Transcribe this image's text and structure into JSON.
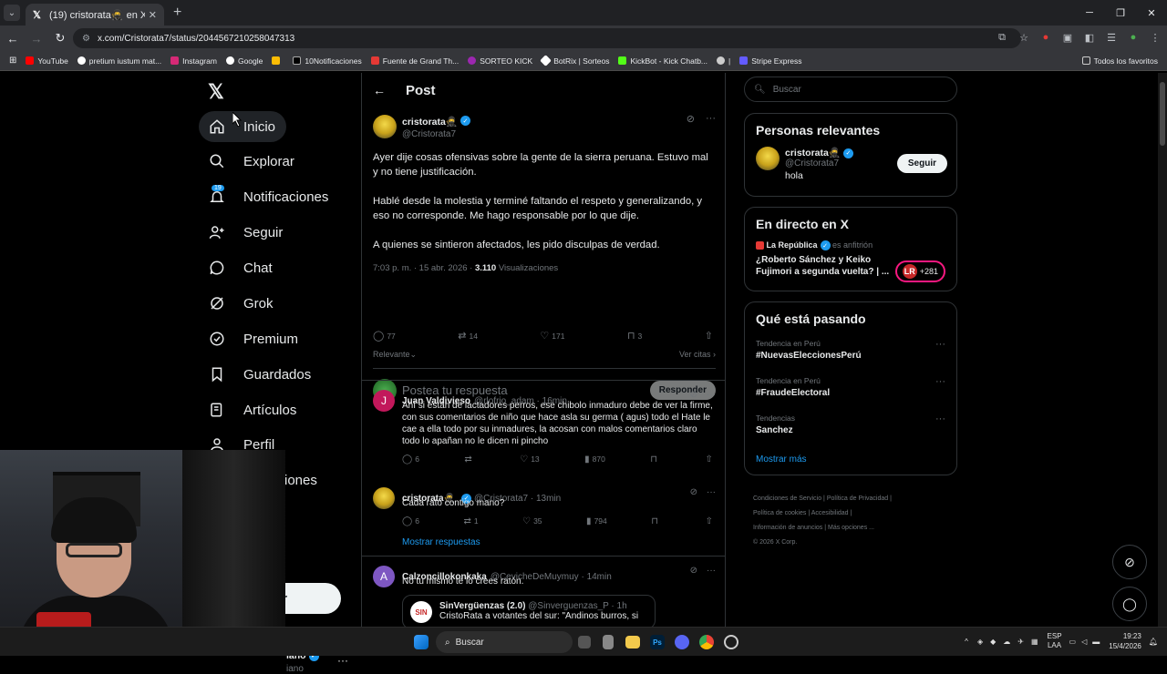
{
  "browser": {
    "tab_title": "(19) cristorata🥷 en X: \"Ayer d...",
    "url": "x.com/Cristorata7/status/2044567210258047313",
    "bookmarks": [
      "YouTube",
      "pretium iustum mat...",
      "Instagram",
      "Google",
      "10Notificaciones",
      "Fuente de Grand Th...",
      "SORTEO KICK",
      "BotRix | Sorteos",
      "KickBot - Kick Chatb...",
      "Stripe Express"
    ],
    "bookmarks_right": "Todos los favoritos"
  },
  "sidebar": {
    "items": [
      {
        "label": "Inicio",
        "icon": "home-icon"
      },
      {
        "label": "Explorar",
        "icon": "search-icon"
      },
      {
        "label": "Notificaciones",
        "icon": "bell-icon",
        "badge": "19"
      },
      {
        "label": "Seguir",
        "icon": "add-user-icon"
      },
      {
        "label": "Chat",
        "icon": "chat-icon"
      },
      {
        "label": "Grok",
        "icon": "grok-icon"
      },
      {
        "label": "Premium",
        "icon": "premium-icon"
      },
      {
        "label": "Guardados",
        "icon": "bookmark-icon"
      },
      {
        "label": "Artículos",
        "icon": "article-icon"
      },
      {
        "label": "Perfil",
        "icon": "profile-icon"
      }
    ],
    "partial_more": "iones",
    "partial_post_btn": "r",
    "partial_user_name": "iano",
    "partial_user_handle": "iano"
  },
  "main": {
    "header_title": "Post",
    "post": {
      "name": "cristorata🥷",
      "handle": "@Cristorata7",
      "paragraphs": [
        "Ayer dije cosas ofensivas sobre la gente de la sierra peruana. Estuvo mal y no tiene justificación.",
        "Hablé desde la molestia y terminé faltando el respeto y generalizando, y eso no corresponde. Me hago responsable por lo que dije.",
        "A quienes se sintieron afectados, les pido disculpas de verdad."
      ],
      "time": "7:03 p. m. · 15 abr. 2026 · ",
      "views": "3.110",
      "views_label": "Visualizaciones",
      "stats": {
        "replies": "77",
        "reposts": "14",
        "likes": "171",
        "bookmarks": "3"
      }
    },
    "sort_label": "Relevante",
    "quotes_label": "Ver citas",
    "reply_placeholder": "Postea tu respuesta",
    "reply_button": "Responder",
    "replies": [
      {
        "name": "Juan Valdivieso",
        "handle": "@rlofrio_adam",
        "time": "16min",
        "initial": "J",
        "text": "Ahí si están de lactadores perros, ese chibolo inmaduro debe de ver la firme, con sus comentarios de niño que hace asla su germa ( agus) todo el Hate le cae a ella todo por su inmadures, la acosan con malos comentarios claro todo lo apañan no le dicen ni pincho",
        "stats": {
          "replies": "6",
          "reposts": "",
          "likes": "13",
          "views": "870"
        }
      },
      {
        "name": "cristorata🥷",
        "handle": "@Cristorata7",
        "time": "13min",
        "text": "Cada rato contigo mano?",
        "stats": {
          "replies": "6",
          "reposts": "1",
          "likes": "35",
          "views": "794"
        },
        "show_more": "Mostrar respuestas"
      },
      {
        "name": "Calzoncillokonkaka",
        "handle": "@CevicheDeMuymuy",
        "time": "14min",
        "initial": "A",
        "text": "No tu mismo te lo crees ratón.",
        "quote": {
          "name": "SinVergüenzas (2.0)",
          "handle": "@Sinverguenzas_P",
          "time": "1h",
          "text": "CristoRata a votantes del sur: \"Andinos burros, si",
          "logo": "SIN"
        }
      }
    ]
  },
  "right": {
    "search_placeholder": "Buscar",
    "relevant_title": "Personas relevantes",
    "relevant_user": {
      "name": "cristorata🥷",
      "handle": "@Cristorata7",
      "bio": "hola",
      "follow": "Seguir"
    },
    "live_title": "En directo en X",
    "live": {
      "source": "La República",
      "host": "es anfitrión",
      "text": "¿Roberto Sánchez y Keiko Fujimori a segunda vuelta? | ...",
      "logo": "LR",
      "count": "+281"
    },
    "trending_title": "Qué está pasando",
    "trends": [
      {
        "context": "Tendencia en Perú",
        "topic": "#NuevasEleccionesPerú"
      },
      {
        "context": "Tendencia en Perú",
        "topic": "#FraudeElectoral"
      },
      {
        "context": "Tendencias",
        "topic": "Sanchez"
      }
    ],
    "show_more": "Mostrar más",
    "footer": [
      "Condiciones de Servicio",
      "Política de Privacidad",
      "Política de cookies",
      "Accesibilidad",
      "Información de anuncios",
      "Más opciones ...",
      "© 2026 X Corp."
    ]
  },
  "taskbar": {
    "search": "Buscar",
    "lang1": "ESP",
    "lang2": "LAA",
    "time": "19:23",
    "date": "15/4/2026"
  },
  "colors": {
    "accent": "#1d9bf0",
    "background": "#000000",
    "border": "#2f3336",
    "muted": "#71767b"
  }
}
